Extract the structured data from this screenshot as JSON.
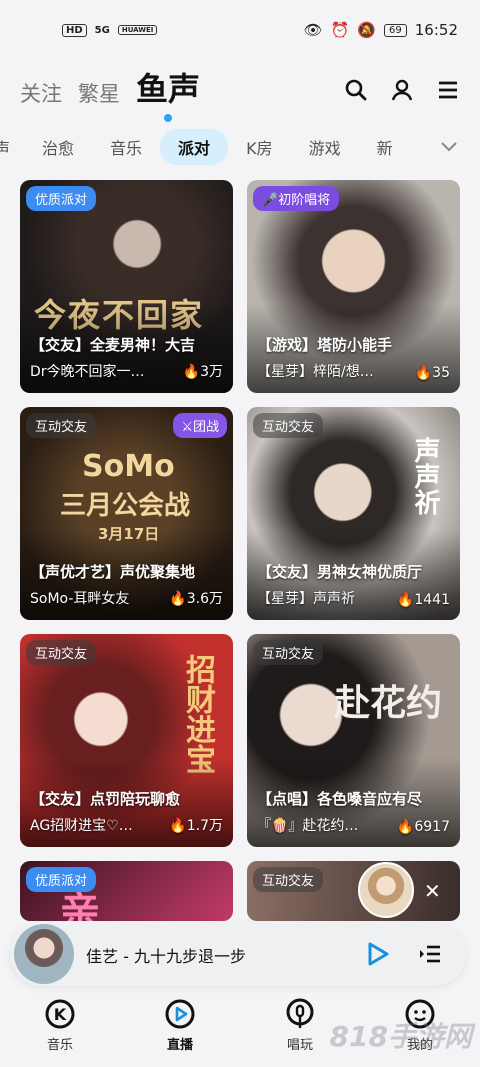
{
  "status_bar": {
    "left_badges": [
      "HD",
      "5G",
      "HUAWEI"
    ],
    "battery": "69",
    "time": "16:52"
  },
  "top_nav": {
    "tabs": [
      "关注",
      "繁星",
      "鱼声"
    ],
    "active": "鱼声"
  },
  "categories": {
    "items": [
      "声",
      "治愈",
      "音乐",
      "派对",
      "K房",
      "游戏",
      "新"
    ],
    "active": "派对"
  },
  "cards": [
    {
      "badge": "优质派对",
      "title": "【交友】全麦男神！大吉",
      "host": "Dr今晚不回家一…",
      "heat": "3万",
      "deco": "今夜不回家"
    },
    {
      "badge": "初阶唱将",
      "title": "【游戏】塔防小能手",
      "host": "【星芽】梓陌/想…",
      "heat": "35"
    },
    {
      "badge": "互动交友",
      "badge2": "团战",
      "title": "【声优才艺】声优聚集地",
      "host": "SoMo-耳畔女友",
      "heat": "3.6万",
      "deco_lines": [
        "SoMo",
        "三月公会战",
        "3月17日"
      ]
    },
    {
      "badge": "互动交友",
      "title": "【交友】男神女神优质厅",
      "host": "【星芽】声声祈",
      "heat": "1441",
      "deco": "声声祈"
    },
    {
      "badge": "互动交友",
      "title": "【交友】点罚陪玩聊愈",
      "host": "AG招财进宝♡…",
      "heat": "1.7万",
      "deco": "招财进宝"
    },
    {
      "badge": "互动交友",
      "title": "【点唱】各色嗓音应有尽",
      "host": "『🍿』赴花约…",
      "heat": "6917",
      "deco": "赴花约"
    },
    {
      "badge": "优质派对",
      "deco": "亲"
    },
    {
      "badge": "互动交友"
    }
  ],
  "player": {
    "song": "佳艺 - 九十九步退一步"
  },
  "bottom_nav": [
    {
      "label": "音乐",
      "icon": "music-k-icon"
    },
    {
      "label": "直播",
      "icon": "live-play-icon"
    },
    {
      "label": "唱玩",
      "icon": "mic-icon"
    },
    {
      "label": "我的",
      "icon": "face-icon"
    }
  ],
  "watermark": "818手游网"
}
